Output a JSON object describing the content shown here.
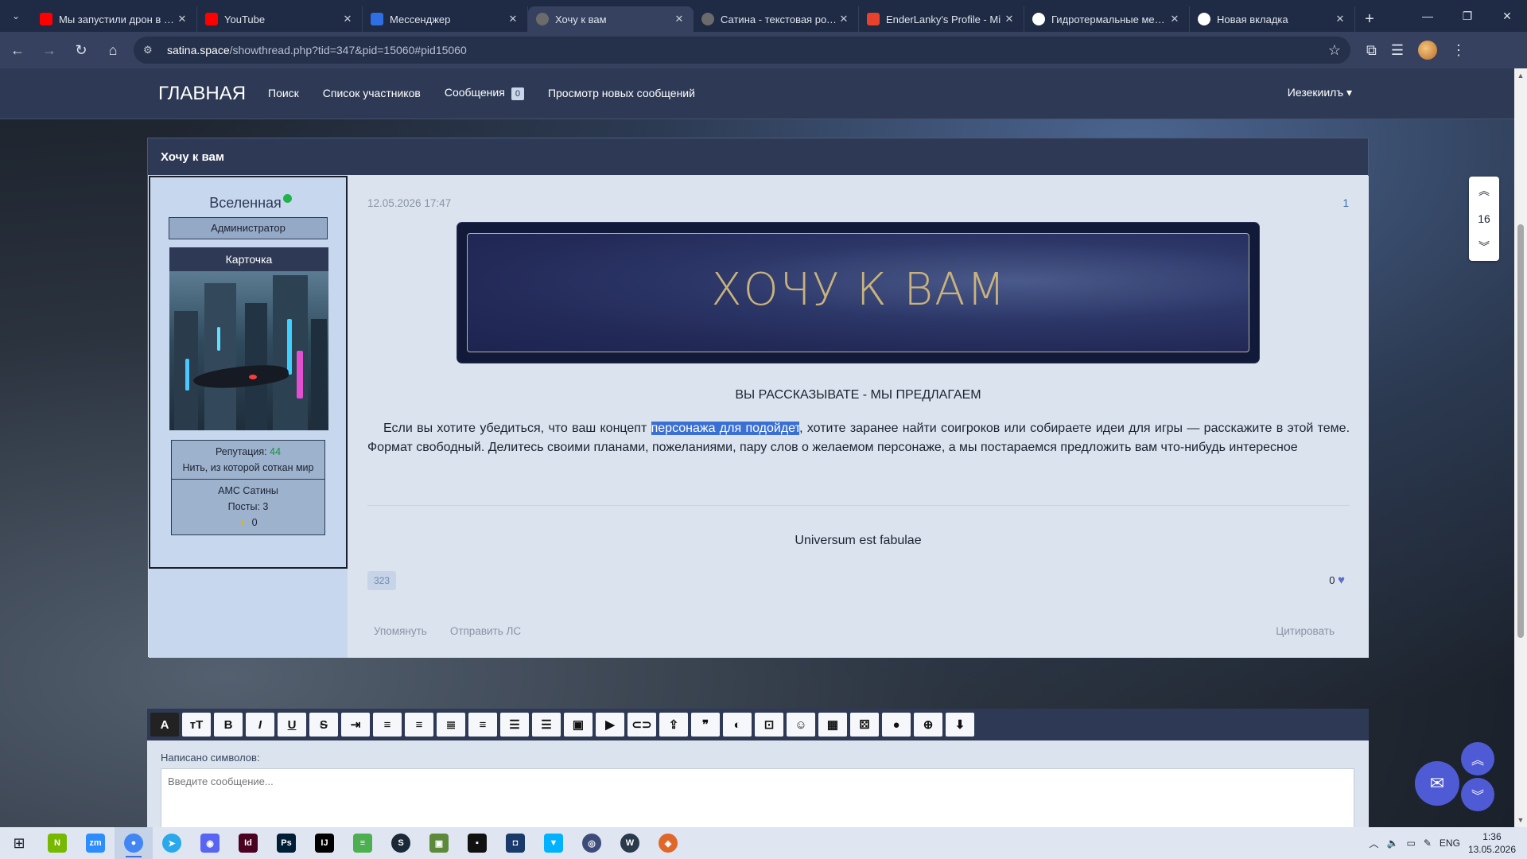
{
  "browser": {
    "tabs": [
      {
        "title": "Мы запустили дрон в стр",
        "color": "#ff0000"
      },
      {
        "title": "YouTube",
        "color": "#ff0000"
      },
      {
        "title": "Мессенджер",
        "color": "#2f6fe4"
      },
      {
        "title": "Хочу к вам",
        "color": "#6b6b6b"
      },
      {
        "title": "Сатина - текстовая ролев",
        "color": "#6b6b6b"
      },
      {
        "title": "EnderLanky's Profile - Mi",
        "color": "#e8412c"
      },
      {
        "title": "Гидротермальные места",
        "color": "#ffffff"
      },
      {
        "title": "Новая вкладка",
        "color": "#ffffff"
      }
    ],
    "url_host": "satina.space",
    "url_path": "/showthread.php?tid=347&pid=15060#pid15060"
  },
  "nav": {
    "brand": "ГЛАВНАЯ",
    "search": "Поиск",
    "members": "Список участников",
    "messages": "Сообщения",
    "messages_count": "0",
    "new_posts": "Просмотр новых сообщений",
    "user": "Иезекиилъ ▾"
  },
  "thread": {
    "title": "Хочу к вам"
  },
  "author": {
    "name": "Вселенная",
    "role": "Администратор",
    "card_title": "Карточка",
    "reputation_label": "Репутация: ",
    "reputation_value": "44",
    "motto": "Нить, из которой соткан мир",
    "group": "АМС Сатины",
    "posts": "Посты: 3",
    "stars_count": "0"
  },
  "post": {
    "date": "12.05.2026 17:47",
    "number": "1",
    "banner_title": "ХОЧУ К ВАМ",
    "subtitle": "ВЫ РАССКАЗЫВАТЕ - МЫ ПРЕДЛАГАЕМ",
    "text_before": "Если вы хотите убедиться, что ваш концепт ",
    "text_highlight": "персонажа для подойдет",
    "text_after": ", хотите заранее найти соигроков или собираете идеи для игры — расскажите в этой теме. Формат свободный. Делитесь своими планами, пожеланиями, пару слов о желаемом персонаже, а мы постараемся предложить вам что-нибудь интересное",
    "signature": "Universum est fabulae",
    "views": "323",
    "likes": "0",
    "action_mention": "Упомянуть",
    "action_pm": "Отправить ЛС",
    "action_quote": "Цитировать"
  },
  "editor": {
    "chars_label": "Написано символов:",
    "placeholder": "Введите сообщение..."
  },
  "pager": {
    "page": "16"
  },
  "taskbar": {
    "apps": [
      {
        "label": "N",
        "color": "#76b900"
      },
      {
        "label": "zm",
        "color": "#2d8cff"
      },
      {
        "label": "●",
        "color": "#4285f4"
      },
      {
        "label": "➤",
        "color": "#29a9eb"
      },
      {
        "label": "◉",
        "color": "#5865f2"
      },
      {
        "label": "Id",
        "color": "#49021f"
      },
      {
        "label": "Ps",
        "color": "#001e36"
      },
      {
        "label": "IJ",
        "color": "#000000"
      },
      {
        "label": "≡",
        "color": "#4caf50"
      },
      {
        "label": "S",
        "color": "#1b2838"
      },
      {
        "label": "▣",
        "color": "#5d8a3a"
      },
      {
        "label": "▪",
        "color": "#111111"
      },
      {
        "label": "◘",
        "color": "#1a3a6b"
      },
      {
        "label": "▼",
        "color": "#00b2ff"
      },
      {
        "label": "◎",
        "color": "#3d4b7a"
      },
      {
        "label": "W",
        "color": "#2a3a4a"
      },
      {
        "label": "◈",
        "color": "#e0672a"
      }
    ],
    "lang": "ENG",
    "time": "1:36",
    "date": "13.05.2026"
  }
}
